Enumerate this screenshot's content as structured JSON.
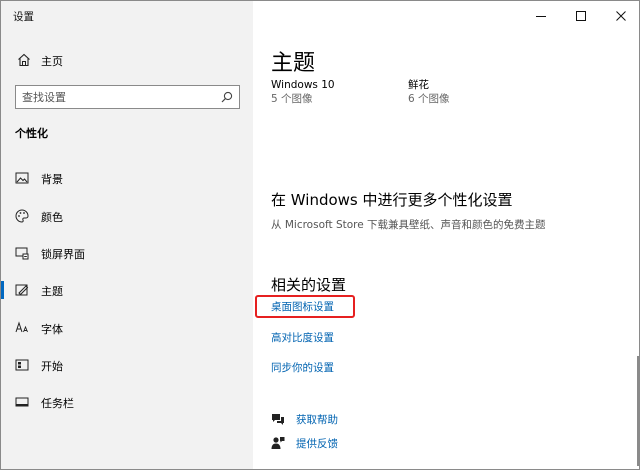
{
  "window": {
    "title": "设置",
    "controls": [
      "minimize-icon",
      "maximize-icon",
      "close-icon"
    ]
  },
  "sidebar": {
    "home_label": "主页",
    "search_placeholder": "查找设置",
    "section_heading": "个性化",
    "items": [
      {
        "label": "背景",
        "icon": "image-icon"
      },
      {
        "label": "颜色",
        "icon": "palette-icon"
      },
      {
        "label": "锁屏界面",
        "icon": "lock-screen-icon"
      },
      {
        "label": "主题",
        "icon": "theme-icon",
        "active": true
      },
      {
        "label": "字体",
        "icon": "font-icon"
      },
      {
        "label": "开始",
        "icon": "start-icon"
      },
      {
        "label": "任务栏",
        "icon": "taskbar-icon"
      }
    ]
  },
  "main": {
    "title": "主题",
    "themes": [
      {
        "name": "Windows 10",
        "count": "5 个图像"
      },
      {
        "name": "鲜花",
        "count": "6 个图像"
      }
    ],
    "more_heading": "在 Windows 中进行更多个性化设置",
    "more_desc": "从 Microsoft Store 下载兼具壁纸、声音和颜色的免费主题",
    "related_heading": "相关的设置",
    "related_links": [
      "桌面图标设置",
      "高对比度设置",
      "同步你的设置"
    ],
    "help": {
      "get_help": "获取帮助",
      "feedback": "提供反馈"
    }
  },
  "colors": {
    "accent": "#0067c0",
    "link": "#0063b1",
    "highlight": "#e62020",
    "sidebar_bg": "#f2f2f2"
  }
}
